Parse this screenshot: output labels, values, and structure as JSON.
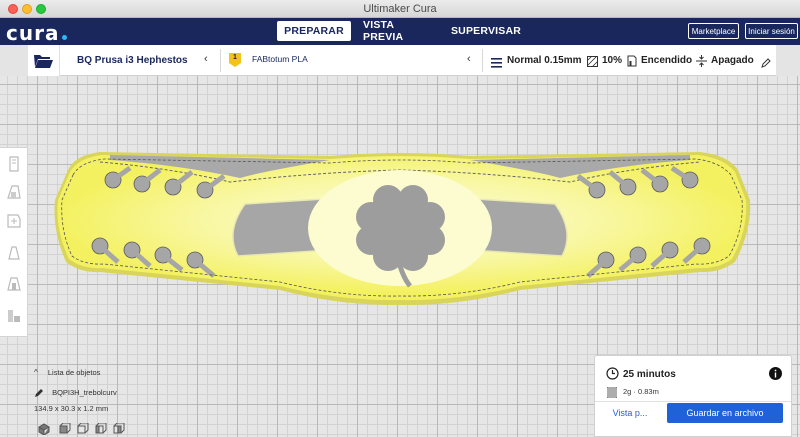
{
  "window": {
    "title": "Ultimaker Cura"
  },
  "header": {
    "logo": "cura",
    "stages": [
      "PREPARAR",
      "VISTA PREVIA",
      "SUPERVISAR"
    ],
    "active_stage": "PREPARAR",
    "marketplace": "Marketplace",
    "login": "Iniciar sesión"
  },
  "toolbar": {
    "printer": "BQ Prusa i3 Hephestos",
    "extruder_number": "1",
    "material": "FABtotum PLA",
    "profile": "Normal 0.15mm",
    "infill": "10%",
    "support": "Encendido",
    "adhesion": "Apagado"
  },
  "object_list": {
    "title": "Lista de objetos",
    "object_name": "BQPI3H_trebolcurv",
    "dimensions": "134.9 x 30.3 x 1.2 mm"
  },
  "print": {
    "time": "25 minutos",
    "material_usage": "2g · 0.83m",
    "preview_button": "Vista p...",
    "save_button": "Guardar en archivo"
  },
  "colors": {
    "header_bg": "#19275c",
    "accent": "#1f61d6",
    "model_yellow": "#f6f266",
    "model_highlight": "#fcfcd0"
  },
  "icons": [
    "folder-icon",
    "printer-chevron-icon",
    "material-badge-icon",
    "infill-icon",
    "support-icon",
    "adhesion-icon",
    "pencil-icon",
    "clock-icon",
    "info-icon",
    "spool-icon"
  ]
}
